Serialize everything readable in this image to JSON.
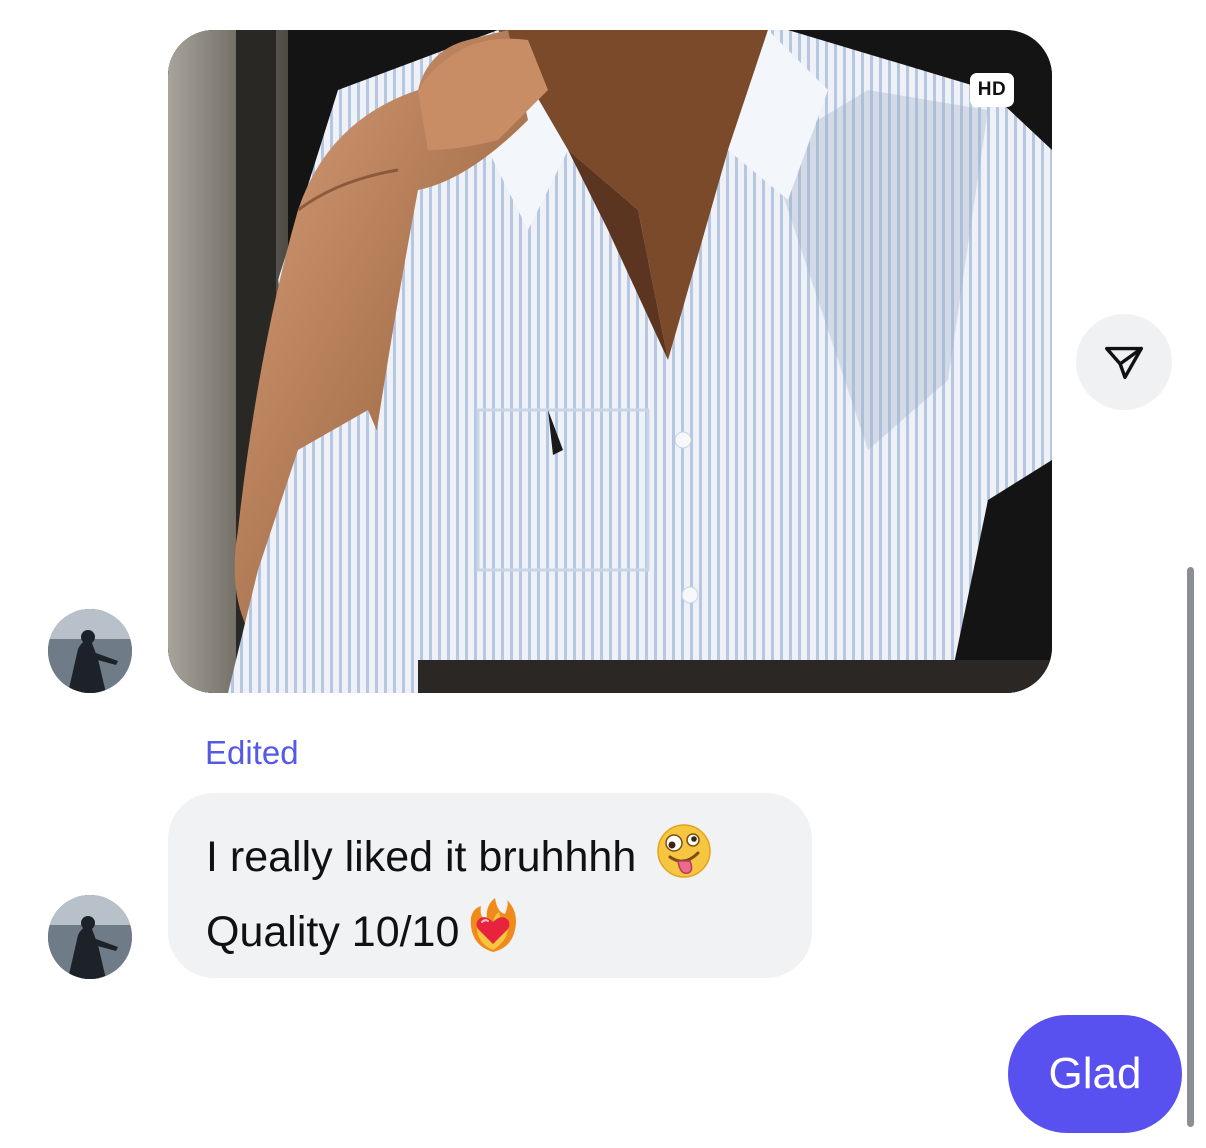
{
  "thread": {
    "image_message": {
      "badge": "HD"
    },
    "edited_label": "Edited",
    "text_message": {
      "line1": "I really liked it bruhhhh",
      "line1_emoji": "zany-face-emoji",
      "line2": "Quality 10/10",
      "line2_emoji": "heart-on-fire-emoji"
    },
    "outgoing_message": {
      "text": "Glad"
    }
  },
  "icons": {
    "share": "paper-plane-icon"
  },
  "colors": {
    "accent": "#5851f0",
    "edited": "#5459e6",
    "incoming_bubble": "#f0f2f4",
    "share_button_bg": "#eff1f3"
  }
}
